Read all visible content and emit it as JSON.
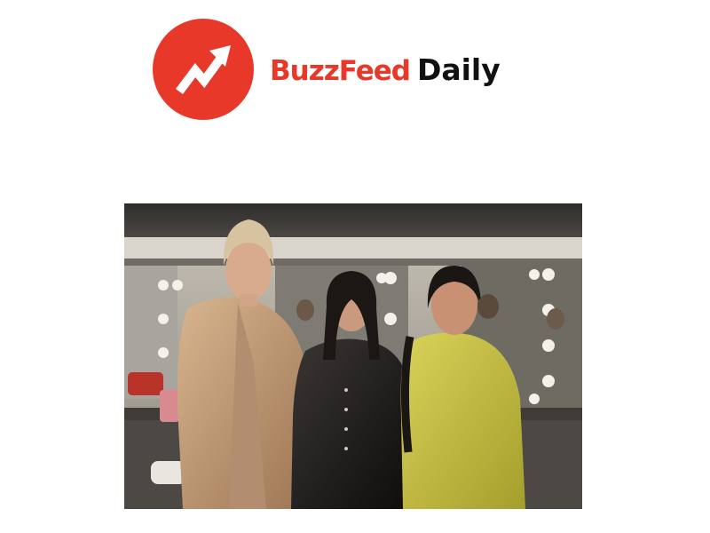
{
  "header": {
    "logo": {
      "icon": "trending-arrow-icon",
      "color": "#e8382a"
    },
    "brand_name": "BuzzFeed",
    "brand_suffix": "Daily"
  },
  "photo": {
    "subject": "three-women-backstage-photo"
  }
}
